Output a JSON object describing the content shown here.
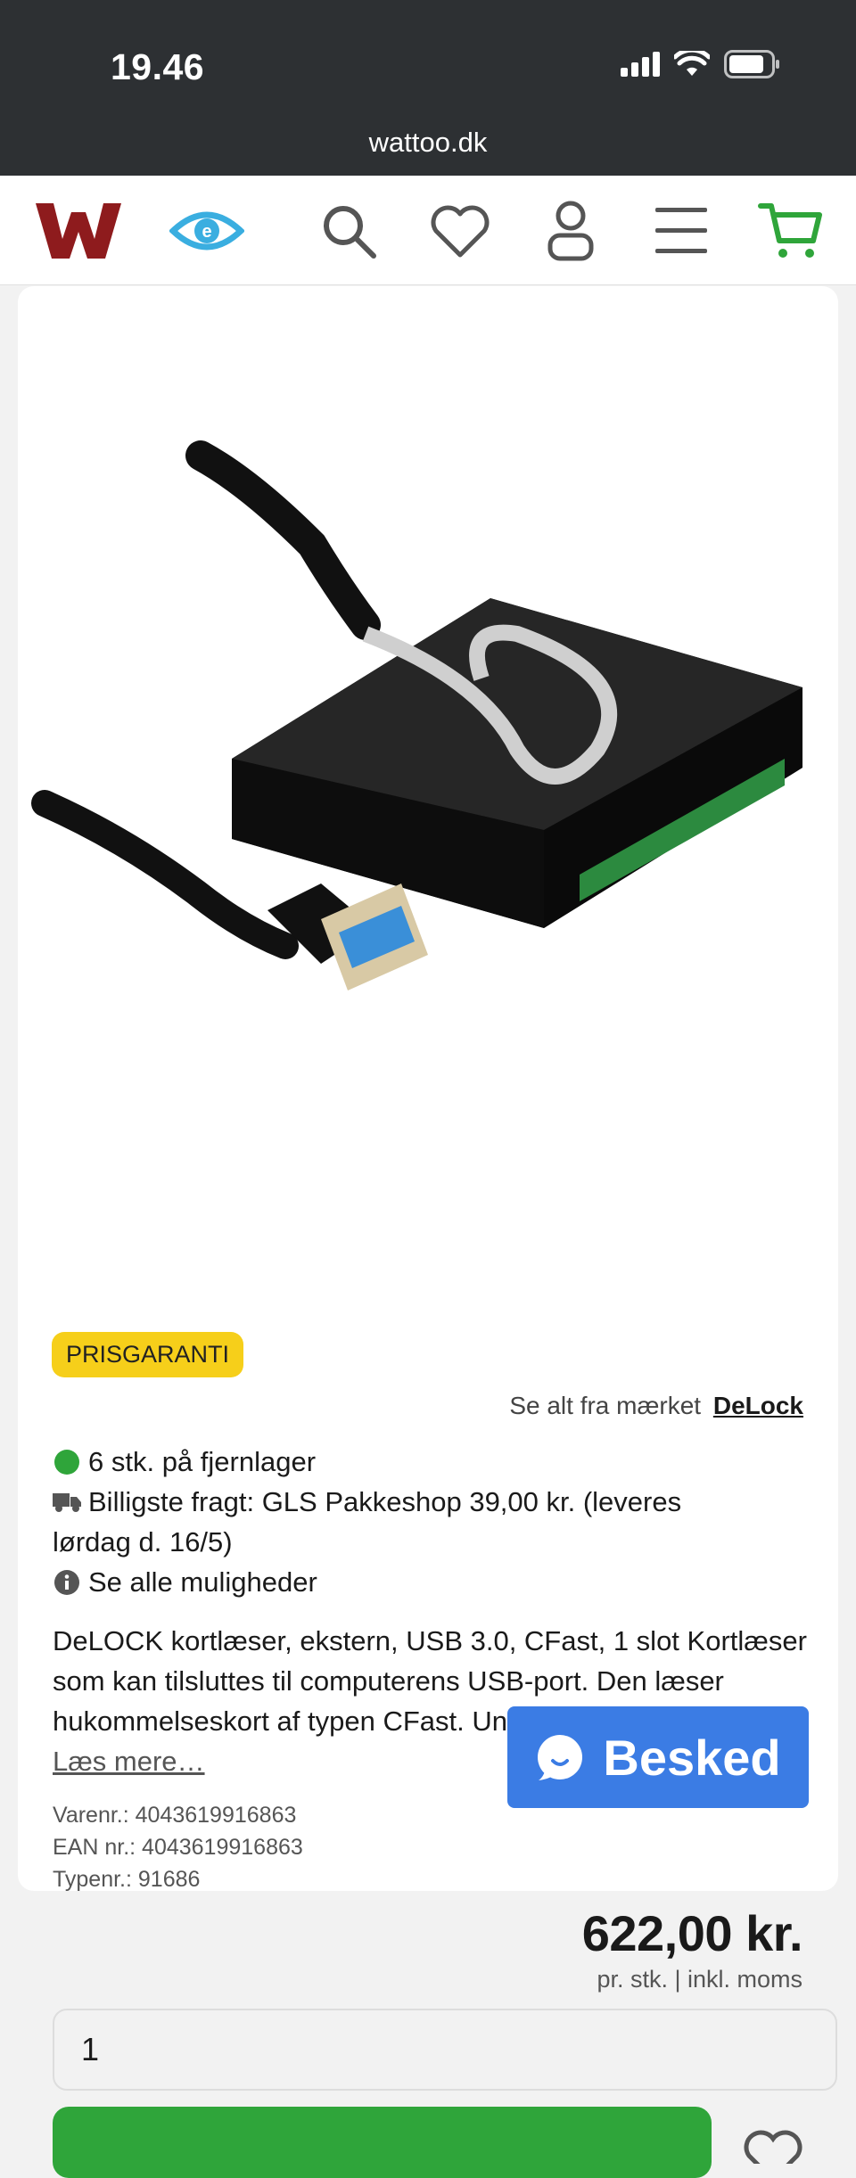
{
  "status_bar": {
    "time": "19.46",
    "url": "wattoo.dk"
  },
  "nav": {
    "icons": [
      "wattoo-logo-icon",
      "eye-icon",
      "search-icon",
      "heart-icon",
      "user-icon",
      "menu-icon",
      "cart-icon"
    ],
    "colors": {
      "logo": "#8e1b1d",
      "eye": "#3aaee0",
      "cart": "#2fa53a"
    }
  },
  "product": {
    "badge": "PRISGARANTI",
    "brand_prefix": "Se alt fra mærket",
    "brand_name": "DeLock",
    "stock": "6 stk. på fjernlager",
    "shipping_line1": "Billigste fragt: GLS Pakkeshop 39,00 kr. (leveres",
    "shipping_line2": "lørdag d. 16/5)",
    "options": "Se alle muligheder",
    "description": "DeLOCK kortlæser, ekstern, USB 3.0, CFast, 1 slot Kortlæser som kan tilsluttes til computerens USB-port. Den læser hukommelseskort af typen CFast. Understøtter : Window...",
    "read_more": "Læs mere…",
    "meta": {
      "varenr": "Varenr.: 4043619916863",
      "ean": "EAN nr.: 4043619916863",
      "typenr": "Typenr.: 91686"
    },
    "price": "622,00 kr.",
    "price_sub": "pr. stk. | inkl. moms",
    "quantity": "1"
  },
  "chat": {
    "label": "Besked"
  },
  "colors": {
    "badge": "#f6cf1a",
    "stock_dot": "#2fa53a",
    "primary_green": "#2fa53a",
    "chat_blue": "#3b7ce4"
  }
}
